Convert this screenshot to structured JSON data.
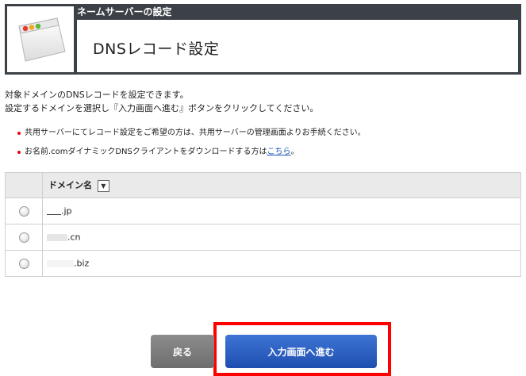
{
  "header": {
    "section_label": "ネームサーバーの設定",
    "title": "DNSレコード設定"
  },
  "description": {
    "line1": "対象ドメインのDNSレコードを設定できます。",
    "line2": "設定するドメインを選択し『入力画面へ進む』ボタンをクリックしてください。"
  },
  "notes": {
    "note1": "共用サーバーにてレコード設定をご希望の方は、共用サーバーの管理画面よりお手続ください。",
    "note2_prefix": "お名前.comダイナミックDNSクライアントをダウンロードする方は",
    "note2_link": "こちら",
    "note2_suffix": "。"
  },
  "table": {
    "column_header": "ドメイン名",
    "sort_icon": "▼",
    "rows": [
      {
        "tld": ".jp",
        "selected": false
      },
      {
        "tld": ".cn",
        "selected": false
      },
      {
        "tld": ".biz",
        "selected": false
      }
    ]
  },
  "buttons": {
    "back": "戻る",
    "next": "入力画面へ進む"
  },
  "colors": {
    "header_bg": "#3c4148",
    "bullet": "#e60012",
    "link": "#1a55b5",
    "next_button": "#2a5fc4",
    "back_button": "#7d7d7d",
    "highlight": "#ff0000"
  }
}
